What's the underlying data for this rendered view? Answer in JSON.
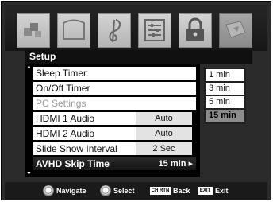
{
  "header": {
    "tabs": [
      {
        "icon": "picture-icon"
      },
      {
        "icon": "screen-icon"
      },
      {
        "icon": "music-note-icon"
      },
      {
        "icon": "equalizer-icon"
      },
      {
        "icon": "lock-icon"
      },
      {
        "icon": "setup-icon"
      }
    ]
  },
  "menu": {
    "title": "Setup",
    "items": [
      {
        "label": "Sleep Timer",
        "value": ""
      },
      {
        "label": "On/Off Timer",
        "value": ""
      },
      {
        "label": "PC Settings",
        "value": ""
      },
      {
        "label": "HDMI 1 Audio",
        "value": "Auto"
      },
      {
        "label": "HDMI 2 Audio",
        "value": "Auto"
      },
      {
        "label": "Slide Show Interval",
        "value": "2 Sec"
      },
      {
        "label": "AVHD Skip Time",
        "value": "15 min ▸"
      }
    ]
  },
  "options": {
    "items": [
      "1 min",
      "3 min",
      "5 min",
      "15 min"
    ]
  },
  "footer": {
    "navigate": "Navigate",
    "select": "Select",
    "back_key": "CH RTN",
    "back": "Back",
    "exit_key": "EXIT",
    "exit": "Exit"
  }
}
